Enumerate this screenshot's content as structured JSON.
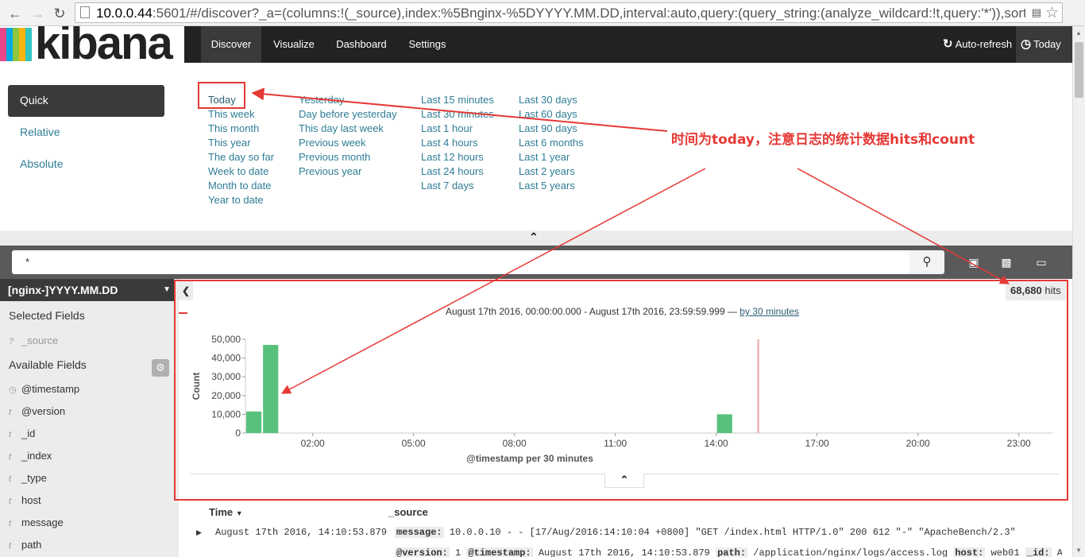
{
  "browser": {
    "url_host": "10.0.0.44",
    "url_rest": ":5601/#/discover?_a=(columns:!(_source),index:%5Bnginx-%5DYYYY.MM.DD,interval:auto,query:(query_string:(analyze_wildcard:!t,query:'*')),sort:!"
  },
  "nav": {
    "logo": "kibana",
    "logo_colors": [
      "#e8478b",
      "#00a9e5",
      "#8cc63f",
      "#f9b410",
      "#33c5c0"
    ],
    "tabs": [
      "Discover",
      "Visualize",
      "Dashboard",
      "Settings"
    ],
    "active_tab": "Discover",
    "auto_refresh": "Auto-refresh",
    "time_label": "Today"
  },
  "timepicker": {
    "modes": [
      "Quick",
      "Relative",
      "Absolute"
    ],
    "active_mode": "Quick",
    "col1": [
      "Today",
      "This week",
      "This month",
      "This year",
      "The day so far",
      "Week to date",
      "Month to date",
      "Year to date"
    ],
    "col2": [
      "Yesterday",
      "Day before yesterday",
      "This day last week",
      "Previous week",
      "Previous month",
      "Previous year"
    ],
    "col3": [
      "Last 15 minutes",
      "Last 30 minutes",
      "Last 1 hour",
      "Last 4 hours",
      "Last 12 hours",
      "Last 24 hours",
      "Last 7 days"
    ],
    "col4": [
      "Last 30 days",
      "Last 60 days",
      "Last 90 days",
      "Last 6 months",
      "Last 1 year",
      "Last 2 years",
      "Last 5 years"
    ]
  },
  "search": {
    "query": "*"
  },
  "sidebar": {
    "index_pattern": "[nginx-]YYYY.MM.DD",
    "selected_heading": "Selected Fields",
    "selected_fields": [
      {
        "type": "?",
        "name": "_source"
      }
    ],
    "available_heading": "Available Fields",
    "available_fields": [
      {
        "type": "clock",
        "name": "@timestamp"
      },
      {
        "type": "t",
        "name": "@version"
      },
      {
        "type": "t",
        "name": "_id"
      },
      {
        "type": "t",
        "name": "_index"
      },
      {
        "type": "t",
        "name": "_type"
      },
      {
        "type": "t",
        "name": "host"
      },
      {
        "type": "t",
        "name": "message"
      },
      {
        "type": "t",
        "name": "path"
      }
    ]
  },
  "results": {
    "hits": "68,680",
    "hits_label": "hits",
    "range": "August 17th 2016, 00:00:00.000 - August 17th 2016, 23:59:59.999 — ",
    "interval_link": "by 30 minutes",
    "columns": [
      "Time",
      "_source"
    ],
    "rows": [
      {
        "time": "August 17th 2016, 14:10:53.879",
        "line1_key": "message:",
        "line1_val": " 10.0.0.10 - - [17/Aug/2016:14:10:04 +0800] \"GET /index.html HTTP/1.0\" 200 612 \"-\" \"ApacheBench/2.3\"",
        "line2": [
          {
            "k": "@version:",
            "v": " 1 "
          },
          {
            "k": "@timestamp:",
            "v": " August 17th 2016, 14:10:53.879 "
          },
          {
            "k": "path:",
            "v": " /application/nginx/logs/access.log "
          },
          {
            "k": "host:",
            "v": " web01 "
          },
          {
            "k": "_id:",
            "v": " AVa"
          }
        ]
      }
    ]
  },
  "chart_data": {
    "type": "bar",
    "title": "",
    "xlabel": "@timestamp per 30 minutes",
    "ylabel": "Count",
    "ylim": [
      0,
      50000
    ],
    "yticks": [
      "0",
      "10,000",
      "20,000",
      "30,000",
      "40,000",
      "50,000"
    ],
    "xticks": [
      "02:00",
      "05:00",
      "08:00",
      "11:00",
      "14:00",
      "17:00",
      "20:00",
      "23:00"
    ],
    "bar_color": "#57c17b",
    "marker_color": "#f0a3a3",
    "bars": [
      {
        "x": "00:00",
        "value": 11500
      },
      {
        "x": "00:30",
        "value": 47000
      },
      {
        "x": "14:00",
        "value": 10000
      }
    ],
    "current_time_marker": "15:15"
  },
  "annotation": {
    "text": "时间为today，注意日志的统计数据hits和count",
    "color": "#e53935"
  }
}
